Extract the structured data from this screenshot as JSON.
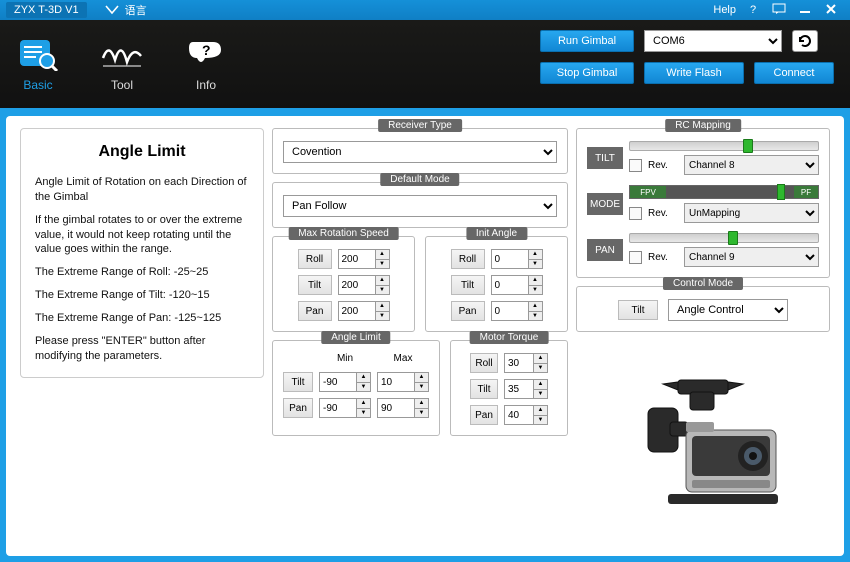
{
  "title": "ZYX T-3D V1",
  "lang_label": "语言",
  "help_label": "Help",
  "tabs": {
    "basic": "Basic",
    "tool": "Tool",
    "info": "Info"
  },
  "buttons": {
    "run": "Run Gimbal",
    "stop": "Stop Gimbal",
    "write": "Write Flash",
    "connect": "Connect"
  },
  "port": "COM6",
  "desc": {
    "title": "Angle Limit",
    "p1": "Angle Limit of Rotation on each Direction of the Gimbal",
    "p2": "If the gimbal rotates to or over the extreme value, it would not keep rotating until the value goes within the range.",
    "p3": "The Extreme Range of Roll: -25~25",
    "p4": "The Extreme Range of Tilt: -120~15",
    "p5": "The Extreme Range of Pan: -125~125",
    "p6": "Please press \"ENTER\" button after modifying the parameters."
  },
  "sections": {
    "receiver": "Receiver Type",
    "defmode": "Default Mode",
    "maxspd": "Max Rotation Speed",
    "initang": "Init Angle",
    "anglimit": "Angle Limit",
    "torque": "Motor Torque",
    "rcmap": "RC Mapping",
    "ctrlmode": "Control Mode"
  },
  "receiver_value": "Covention",
  "defmode_value": "Pan Follow",
  "labels": {
    "roll": "Roll",
    "tilt": "Tilt",
    "pan": "Pan",
    "min": "Min",
    "max": "Max",
    "rev": "Rev.",
    "mode": "MODE",
    "tilt_caps": "TILT",
    "pan_caps": "PAN",
    "fpv": "FPV",
    "pf": "PF"
  },
  "maxspd": {
    "roll": "200",
    "tilt": "200",
    "pan": "200"
  },
  "initang": {
    "roll": "0",
    "tilt": "0",
    "pan": "0"
  },
  "anglimit": {
    "tilt_min": "-90",
    "tilt_max": "10",
    "pan_min": "-90",
    "pan_max": "90"
  },
  "torque": {
    "roll": "30",
    "tilt": "35",
    "pan": "40"
  },
  "rc": {
    "tilt_channel": "Channel 8",
    "mode_channel": "UnMapping",
    "pan_channel": "Channel 9"
  },
  "ctrlmode": {
    "axis": "Tilt",
    "mode": "Angle Control"
  }
}
